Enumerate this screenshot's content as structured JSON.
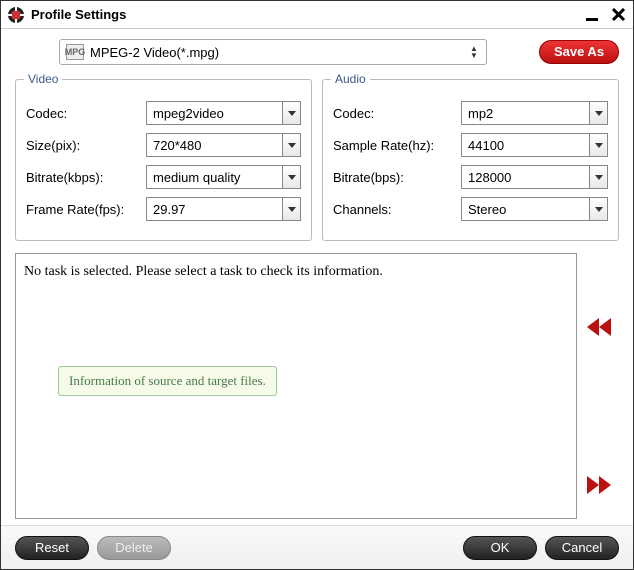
{
  "window": {
    "title": "Profile Settings"
  },
  "profile": {
    "selected": "MPEG-2 Video(*.mpg)",
    "format_badge": "MPG",
    "save_as_label": "Save As"
  },
  "video": {
    "legend": "Video",
    "codec_label": "Codec:",
    "codec_value": "mpeg2video",
    "size_label": "Size(pix):",
    "size_value": "720*480",
    "bitrate_label": "Bitrate(kbps):",
    "bitrate_value": "medium quality",
    "framerate_label": "Frame Rate(fps):",
    "framerate_value": "29.97"
  },
  "audio": {
    "legend": "Audio",
    "codec_label": "Codec:",
    "codec_value": "mp2",
    "samplerate_label": "Sample Rate(hz):",
    "samplerate_value": "44100",
    "bitrate_label": "Bitrate(bps):",
    "bitrate_value": "128000",
    "channels_label": "Channels:",
    "channels_value": "Stereo"
  },
  "info": {
    "message": "No task is selected. Please select a task to check its information.",
    "tooltip": "Information of source and target files."
  },
  "footer": {
    "reset": "Reset",
    "delete": "Delete",
    "ok": "OK",
    "cancel": "Cancel"
  },
  "colors": {
    "accent_red": "#cc1a1a",
    "group_border": "#bbbbbb",
    "legend_text": "#3a5a8a",
    "tooltip_bg": "#f5fbe8",
    "tooltip_border": "#99cc99"
  }
}
